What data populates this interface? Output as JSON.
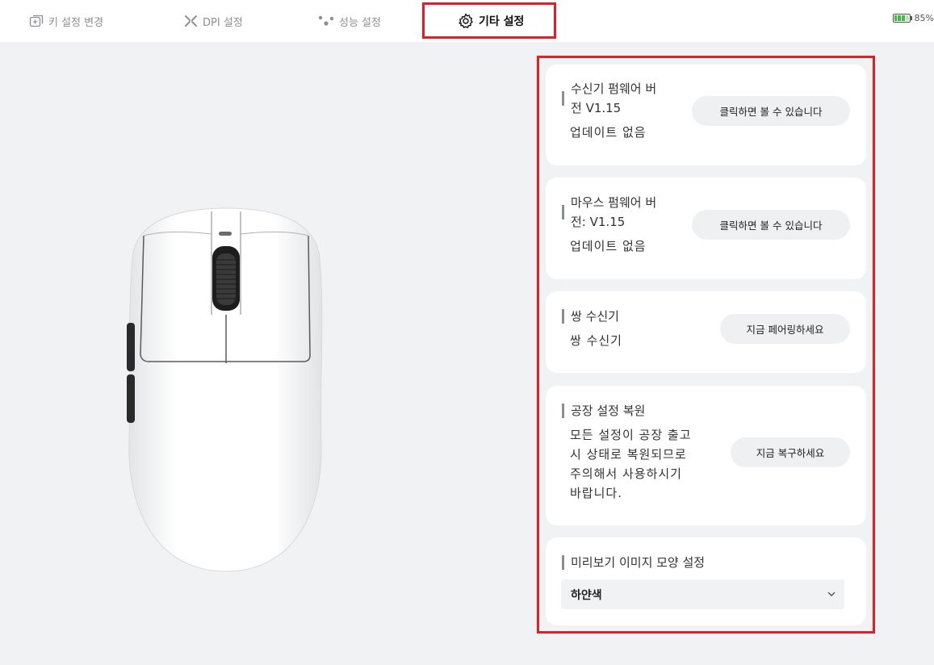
{
  "tabs": [
    {
      "label": "키 설정 변경",
      "icon": "key-settings-icon",
      "active": false
    },
    {
      "label": "DPI 설정",
      "icon": "dpi-icon",
      "active": false
    },
    {
      "label": "성능 설정",
      "icon": "performance-icon",
      "active": false
    },
    {
      "label": "기타 설정",
      "icon": "gear-icon",
      "active": true
    }
  ],
  "battery": {
    "level_label": "85%",
    "level": 0.85,
    "color": "#3fbf3f"
  },
  "cards": {
    "receiver_fw": {
      "title_line1": "수신기 펌웨어 버",
      "title_line2": "전 V1.15",
      "status": "업데이트 없음",
      "button": "클릭하면 볼 수 있습니다"
    },
    "mouse_fw": {
      "title_line1": "마우스 펌웨어 버",
      "title_line2": "전: V1.15",
      "status": "업데이트 없음",
      "button": "클릭하면 볼 수 있습니다"
    },
    "dual_receiver": {
      "title": "쌍 수신기",
      "status": "쌍 수신기",
      "button": "지금 페어링하세요"
    },
    "factory_reset": {
      "title": "공장 설정 복원",
      "desc_lines": [
        "모든 설정이 공장 출고",
        "시 상태로 복원되므로",
        "주의해서 사용하시기",
        "바랍니다."
      ],
      "button": "지금 복구하세요"
    },
    "preview": {
      "title": "미리보기 이미지 모양 설정",
      "selected": "하얀색"
    }
  },
  "colors": {
    "highlight": "#e02027",
    "background": "#f1f2f4",
    "card": "#ffffff",
    "button": "#eff0f2"
  }
}
